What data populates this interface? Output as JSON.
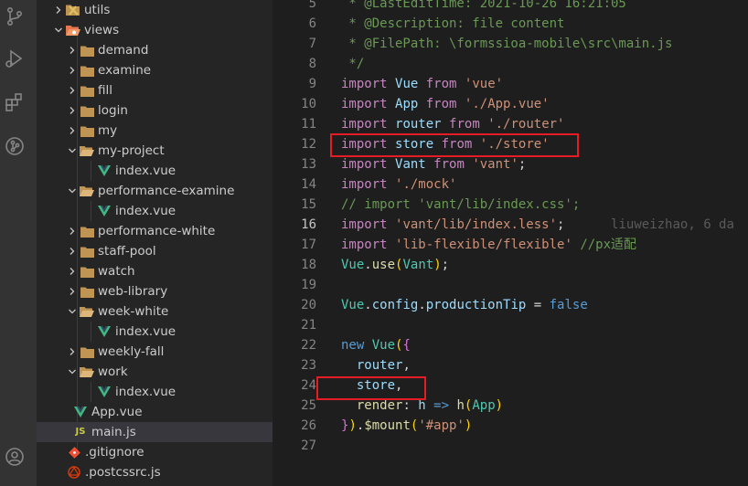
{
  "activity_bar": {
    "icons": [
      "source-control-icon",
      "run-debug-icon",
      "extensions-icon",
      "git-graph-icon",
      "account-icon"
    ]
  },
  "explorer": {
    "items": [
      {
        "label": "utils",
        "kind": "folder-utils",
        "chevron": "right"
      },
      {
        "label": "views",
        "kind": "folder-views",
        "chevron": "down"
      },
      {
        "label": "demand",
        "kind": "folder",
        "chevron": "right"
      },
      {
        "label": "examine",
        "kind": "folder",
        "chevron": "right"
      },
      {
        "label": "fill",
        "kind": "folder",
        "chevron": "right"
      },
      {
        "label": "login",
        "kind": "folder",
        "chevron": "right"
      },
      {
        "label": "my",
        "kind": "folder",
        "chevron": "right"
      },
      {
        "label": "my-project",
        "kind": "folder-open",
        "chevron": "down"
      },
      {
        "label": "index.vue",
        "kind": "vue",
        "chevron": ""
      },
      {
        "label": "performance-examine",
        "kind": "folder-open",
        "chevron": "down"
      },
      {
        "label": "index.vue",
        "kind": "vue",
        "chevron": ""
      },
      {
        "label": "performance-white",
        "kind": "folder",
        "chevron": "right"
      },
      {
        "label": "staff-pool",
        "kind": "folder",
        "chevron": "right"
      },
      {
        "label": "watch",
        "kind": "folder",
        "chevron": "right"
      },
      {
        "label": "web-library",
        "kind": "folder",
        "chevron": "right"
      },
      {
        "label": "week-white",
        "kind": "folder-open",
        "chevron": "down"
      },
      {
        "label": "index.vue",
        "kind": "vue",
        "chevron": ""
      },
      {
        "label": "weekly-fall",
        "kind": "folder",
        "chevron": "right"
      },
      {
        "label": "work",
        "kind": "folder-open",
        "chevron": "down"
      },
      {
        "label": "index.vue",
        "kind": "vue",
        "chevron": ""
      },
      {
        "label": "App.vue",
        "kind": "vue",
        "chevron": ""
      },
      {
        "label": "main.js",
        "kind": "js",
        "chevron": ""
      },
      {
        "label": ".gitignore",
        "kind": "git",
        "chevron": ""
      },
      {
        "label": ".postcssrc.js",
        "kind": "postcss",
        "chevron": ""
      }
    ]
  },
  "editor": {
    "line_numbers": [
      "5",
      "6",
      "7",
      "8",
      "9",
      "10",
      "11",
      "12",
      "13",
      "14",
      "15",
      "16",
      "17",
      "18",
      "19",
      "20",
      "21",
      "22",
      "23",
      "24",
      "25",
      "26",
      "27"
    ],
    "current_line": "16",
    "lines": [
      [
        [
          "cm",
          " * @LastEditTime: 2021-10-26 16:21:05"
        ]
      ],
      [
        [
          "cm",
          " * @Description: file content"
        ]
      ],
      [
        [
          "cm",
          " * @FilePath: \\formssioa-mobile\\src\\main.js"
        ]
      ],
      [
        [
          "cm",
          " */"
        ]
      ],
      [
        [
          "kw",
          "import"
        ],
        [
          "pl",
          " "
        ],
        [
          "var",
          "Vue"
        ],
        [
          "pl",
          " "
        ],
        [
          "kw",
          "from"
        ],
        [
          "pl",
          " "
        ],
        [
          "str",
          "'vue'"
        ]
      ],
      [
        [
          "kw",
          "import"
        ],
        [
          "pl",
          " "
        ],
        [
          "var",
          "App"
        ],
        [
          "pl",
          " "
        ],
        [
          "kw",
          "from"
        ],
        [
          "pl",
          " "
        ],
        [
          "str",
          "'./App.vue'"
        ]
      ],
      [
        [
          "kw",
          "import"
        ],
        [
          "pl",
          " "
        ],
        [
          "var",
          "router"
        ],
        [
          "pl",
          " "
        ],
        [
          "kw",
          "from"
        ],
        [
          "pl",
          " "
        ],
        [
          "str",
          "'./router'"
        ]
      ],
      [
        [
          "kw",
          "import"
        ],
        [
          "pl",
          " "
        ],
        [
          "var",
          "store"
        ],
        [
          "pl",
          " "
        ],
        [
          "kw",
          "from"
        ],
        [
          "pl",
          " "
        ],
        [
          "str",
          "'./store'"
        ]
      ],
      [
        [
          "kw",
          "import"
        ],
        [
          "pl",
          " "
        ],
        [
          "var",
          "Vant"
        ],
        [
          "pl",
          " "
        ],
        [
          "kw",
          "from"
        ],
        [
          "pl",
          " "
        ],
        [
          "str",
          "'vant'"
        ],
        [
          "pl",
          ";"
        ]
      ],
      [
        [
          "kw",
          "import"
        ],
        [
          "pl",
          " "
        ],
        [
          "str",
          "'./mock'"
        ]
      ],
      [
        [
          "cm",
          "// import 'vant/lib/index.css';"
        ]
      ],
      [
        [
          "kw",
          "import"
        ],
        [
          "pl",
          " "
        ],
        [
          "str",
          "'vant/lib/index.less'"
        ],
        [
          "pl",
          ";"
        ],
        [
          "pl",
          "      "
        ],
        [
          "blame",
          "liuweizhao, 6 da"
        ]
      ],
      [
        [
          "kw",
          "import"
        ],
        [
          "pl",
          " "
        ],
        [
          "str",
          "'lib-flexible/flexible'"
        ],
        [
          "pl",
          " "
        ],
        [
          "cm",
          "//px适配"
        ]
      ],
      [
        [
          "cls",
          "Vue"
        ],
        [
          "pl",
          "."
        ],
        [
          "fn",
          "use"
        ],
        [
          "br2",
          "("
        ],
        [
          "cls",
          "Vant"
        ],
        [
          "br2",
          ")"
        ],
        [
          "pl",
          ";"
        ]
      ],
      [],
      [
        [
          "cls",
          "Vue"
        ],
        [
          "pl",
          "."
        ],
        [
          "var",
          "config"
        ],
        [
          "pl",
          "."
        ],
        [
          "var",
          "productionTip"
        ],
        [
          "pl",
          " = "
        ],
        [
          "kw2",
          "false"
        ]
      ],
      [],
      [
        [
          "kw2",
          "new"
        ],
        [
          "pl",
          " "
        ],
        [
          "cls",
          "Vue"
        ],
        [
          "br2",
          "("
        ],
        [
          "br1",
          "{"
        ]
      ],
      [
        [
          "pl",
          "  "
        ],
        [
          "var",
          "router"
        ],
        [
          "pl",
          ","
        ]
      ],
      [
        [
          "pl",
          "  "
        ],
        [
          "var",
          "store"
        ],
        [
          "pl",
          ","
        ]
      ],
      [
        [
          "pl",
          "  "
        ],
        [
          "fn",
          "render"
        ],
        [
          "pl",
          ": "
        ],
        [
          "var",
          "h"
        ],
        [
          "pl",
          " "
        ],
        [
          "kw2",
          "=>"
        ],
        [
          "pl",
          " "
        ],
        [
          "fn",
          "h"
        ],
        [
          "br2",
          "("
        ],
        [
          "cls",
          "App"
        ],
        [
          "br2",
          ")"
        ]
      ],
      [
        [
          "br1",
          "}"
        ],
        [
          "br2",
          ")"
        ],
        [
          "pl",
          "."
        ],
        [
          "fn",
          "$mount"
        ],
        [
          "br2",
          "("
        ],
        [
          "str",
          "'#app'"
        ],
        [
          "br2",
          ")"
        ]
      ],
      []
    ]
  },
  "colors": {
    "highlight_box": "#e51c23",
    "vue_icon": "#41b883",
    "folder_icon": "#c09553",
    "js_icon": "#cbcb41"
  }
}
